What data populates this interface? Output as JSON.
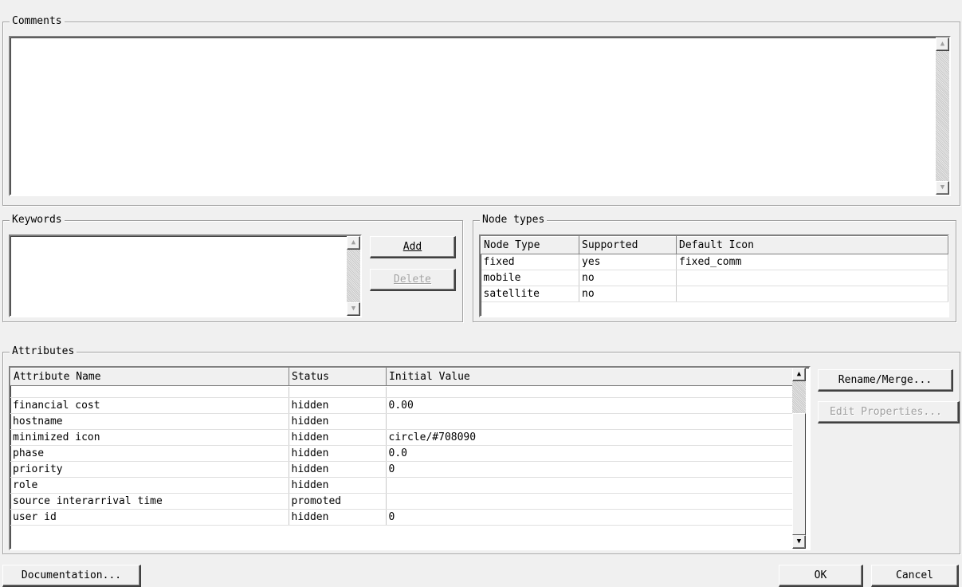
{
  "comments": {
    "label": "Comments",
    "text": ""
  },
  "keywords": {
    "label": "Keywords",
    "add_label": "Add",
    "delete_label": "Delete"
  },
  "node_types": {
    "label": "Node types",
    "columns": [
      "Node Type",
      "Supported",
      "Default Icon"
    ],
    "rows": [
      [
        "fixed",
        "yes",
        "fixed_comm"
      ],
      [
        "mobile",
        "no",
        ""
      ],
      [
        "satellite",
        "no",
        ""
      ]
    ]
  },
  "attributes": {
    "label": "Attributes",
    "columns": [
      "Attribute Name",
      "Status",
      "Initial Value"
    ],
    "rows": [
      [
        "financial cost",
        "hidden",
        "0.00"
      ],
      [
        "hostname",
        "hidden",
        ""
      ],
      [
        "minimized icon",
        "hidden",
        "circle/#708090"
      ],
      [
        "phase",
        "hidden",
        "0.0"
      ],
      [
        "priority",
        "hidden",
        "0"
      ],
      [
        "role",
        "hidden",
        ""
      ],
      [
        "source interarrival time",
        "promoted",
        ""
      ],
      [
        "user id",
        "hidden",
        "0"
      ]
    ],
    "rename_label": "Rename/Merge...",
    "edit_label": "Edit Properties..."
  },
  "footer": {
    "documentation_label": "Documentation...",
    "ok_label": "OK",
    "cancel_label": "Cancel"
  },
  "icons": {
    "up": "scroll-up-arrow",
    "down": "scroll-down-arrow"
  }
}
